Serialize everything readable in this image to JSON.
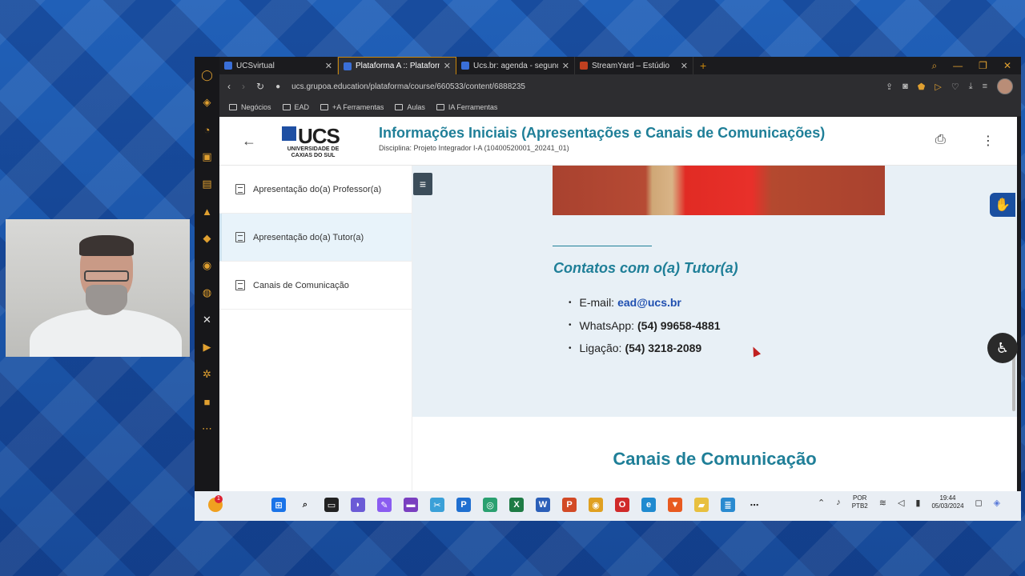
{
  "browser": {
    "tabs": [
      {
        "label": "UCSvirtual",
        "active": false
      },
      {
        "label": "Plataforma A :: Plataforma",
        "active": true
      },
      {
        "label": "Ucs.br: agenda - segunda-f",
        "active": false
      },
      {
        "label": "StreamYard – Estúdio",
        "active": false
      }
    ],
    "new_tab_symbol": "+",
    "url": "ucs.grupoa.education/plataforma/course/660533/content/6888235",
    "bookmarks": [
      "Negócios",
      "EAD",
      "+A Ferramentas",
      "Aulas",
      "IA Ferramentas"
    ]
  },
  "header": {
    "logo_text": "UCS",
    "logo_sub": "UNIVERSIDADE DE CAXIAS DO SUL",
    "title": "Informações Iniciais (Apresentações e Canais de Comunicações)",
    "discipline": "Disciplina: Projeto Integrador I-A (10400520001_20241_01)"
  },
  "sidebar": {
    "items": [
      {
        "label": "Apresentação do(a) Professor(a)",
        "active": false
      },
      {
        "label": "Apresentação do(a) Tutor(a)",
        "active": true
      },
      {
        "label": "Canais de Comunicação",
        "active": false
      }
    ]
  },
  "content": {
    "divider": "______________",
    "contacts_heading": "Contatos com o(a) Tutor(a)",
    "email_label": "E-mail:",
    "email_value": "ead@ucs.br",
    "whatsapp_label": "WhatsApp:",
    "whatsapp_value": "(54) 99658-4881",
    "phone_label": "Ligação:",
    "phone_value": "(54) 3218-2089",
    "section_heading": "Canais de Comunicação"
  },
  "taskbar": {
    "notification_count": "1",
    "language": "POR",
    "keyboard": "PTB2",
    "time": "19:44",
    "date": "05/03/2024"
  },
  "colors": {
    "accent": "#1f7f98",
    "link": "#1f4fb0",
    "content_bg": "#e8f0f6",
    "opera_accent": "#e0a030"
  }
}
